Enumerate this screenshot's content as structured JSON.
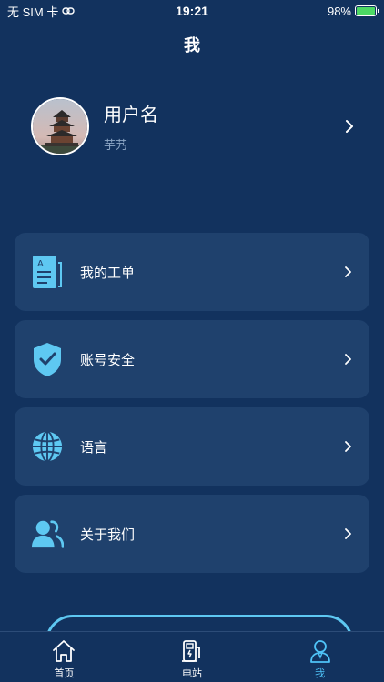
{
  "status_bar": {
    "carrier": "无 SIM 卡",
    "time": "19:21",
    "battery": "98%",
    "battery_level": 0.98
  },
  "page": {
    "title": "我"
  },
  "profile": {
    "username": "用户名",
    "nickname": "芋艿"
  },
  "menu": {
    "items": [
      {
        "label": "我的工单",
        "icon": "work-order-icon"
      },
      {
        "label": "账号安全",
        "icon": "shield-check-icon"
      },
      {
        "label": "语言",
        "icon": "globe-icon"
      },
      {
        "label": "关于我们",
        "icon": "people-icon"
      }
    ]
  },
  "tabs": [
    {
      "label": "首页",
      "icon": "home-icon",
      "active": false
    },
    {
      "label": "电站",
      "icon": "charging-station-icon",
      "active": false
    },
    {
      "label": "我",
      "icon": "user-icon",
      "active": true
    }
  ],
  "colors": {
    "background": "#12325e",
    "card": "#1f416d",
    "accent": "#4fc3f7",
    "icon": "#5ec8f2"
  }
}
